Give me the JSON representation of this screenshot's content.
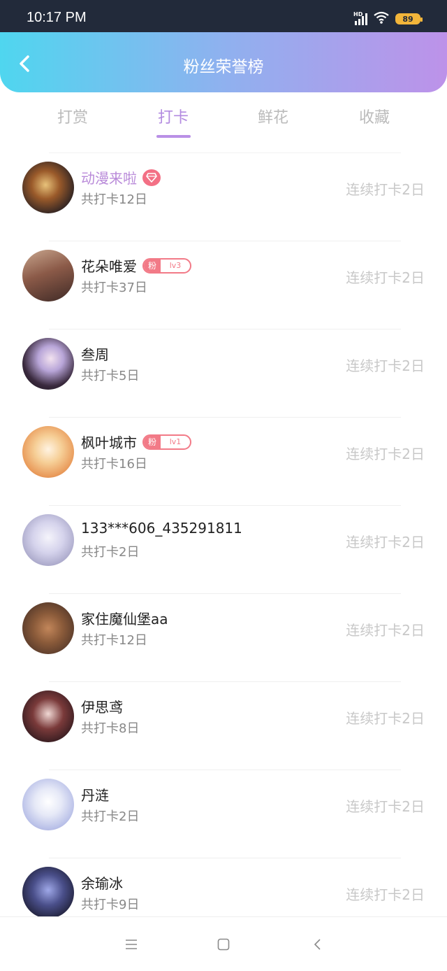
{
  "status_bar": {
    "time": "10:17 PM",
    "network_label": "HD",
    "battery": "89"
  },
  "header": {
    "title": "粉丝荣誉榜"
  },
  "tabs": [
    {
      "label": "打赏",
      "active": false
    },
    {
      "label": "打卡",
      "active": true
    },
    {
      "label": "鲜花",
      "active": false
    },
    {
      "label": "收藏",
      "active": false
    }
  ],
  "fans": [
    {
      "name": "动漫来啦",
      "total": "共打卡12日",
      "streak": "连续打卡2日",
      "badge": "gem"
    },
    {
      "name": "花朵唯爱",
      "total": "共打卡37日",
      "streak": "连续打卡2日",
      "badge": "fan",
      "badge_label": "粉",
      "badge_level": "lv3"
    },
    {
      "name": "叁周",
      "total": "共打卡5日",
      "streak": "连续打卡2日"
    },
    {
      "name": "枫叶城市",
      "total": "共打卡16日",
      "streak": "连续打卡2日",
      "badge": "fan",
      "badge_label": "粉",
      "badge_level": "lv1"
    },
    {
      "name": "133***606_435291811",
      "total": "共打卡2日",
      "streak": "连续打卡2日"
    },
    {
      "name": "家住魔仙堡aa",
      "total": "共打卡12日",
      "streak": "连续打卡2日"
    },
    {
      "name": "伊思鸢",
      "total": "共打卡8日",
      "streak": "连续打卡2日"
    },
    {
      "name": "丹涟",
      "total": "共打卡2日",
      "streak": "连续打卡2日"
    },
    {
      "name": "余瑜冰",
      "total": "共打卡9日",
      "streak": "连续打卡2日"
    }
  ],
  "colors": {
    "accent": "#b38be0",
    "header_gradient": [
      "#4fd6ef",
      "#8fb1ef",
      "#bd92e9"
    ],
    "fan_badge": "#f27a87",
    "streak_text": "#c8c8c8"
  },
  "icons": {
    "back": "chevron-left-icon",
    "gem": "diamond-icon",
    "nav": [
      "menu-icon",
      "home-square-icon",
      "back-triangle-icon"
    ]
  }
}
